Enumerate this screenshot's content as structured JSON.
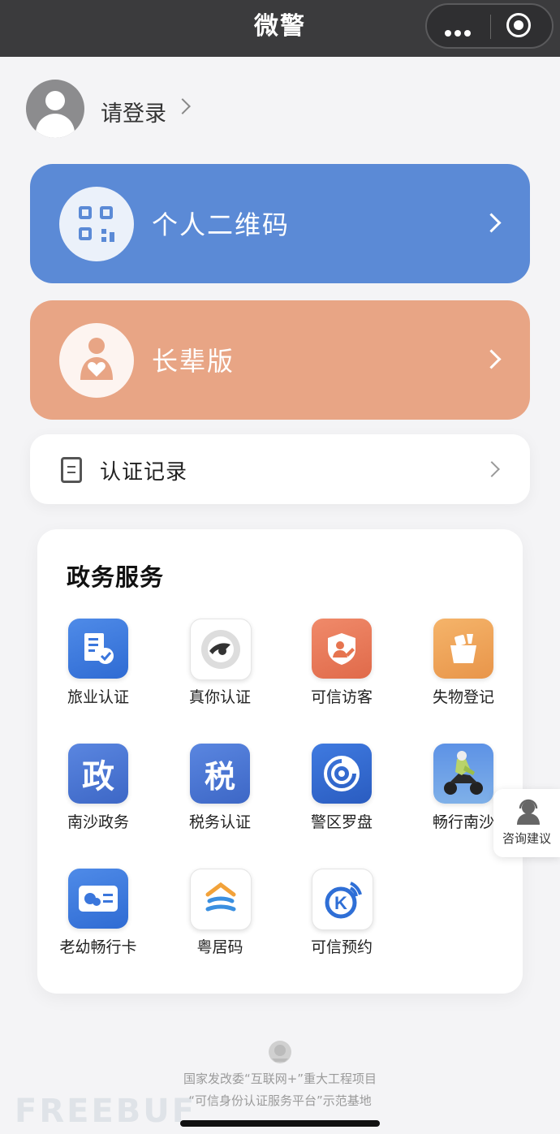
{
  "topbar": {
    "title": "微警"
  },
  "login": {
    "label": "请登录"
  },
  "cards": {
    "qr": {
      "label": "个人二维码",
      "color": "#5b8ad6"
    },
    "elder": {
      "label": "长辈版",
      "color": "#e8a585"
    }
  },
  "record": {
    "label": "认证记录"
  },
  "gov": {
    "heading": "政务服务",
    "items": [
      {
        "label": "旅业认证",
        "icon": "hotel-certify-icon"
      },
      {
        "label": "真你认证",
        "icon": "real-you-certify-icon"
      },
      {
        "label": "可信访客",
        "icon": "trusted-visitor-icon"
      },
      {
        "label": "失物登记",
        "icon": "lost-item-icon"
      },
      {
        "label": "南沙政务",
        "icon": "nansha-gov-icon",
        "glyph": "政"
      },
      {
        "label": "税务认证",
        "icon": "tax-certify-icon",
        "glyph": "税"
      },
      {
        "label": "警区罗盘",
        "icon": "police-compass-icon"
      },
      {
        "label": "畅行南沙",
        "icon": "traffic-nansha-icon"
      },
      {
        "label": "老幼畅行卡",
        "icon": "elder-child-card-icon"
      },
      {
        "label": "粤居码",
        "icon": "yue-residence-code-icon"
      },
      {
        "label": "可信预约",
        "icon": "trusted-booking-icon",
        "glyph": "K"
      }
    ]
  },
  "consult": {
    "label": "咨询建议"
  },
  "footer": {
    "line1": "国家发改委“互联网+”重大工程项目",
    "line2": "“可信身份认证服务平台”示范基地"
  },
  "watermark": "FREEBUF"
}
